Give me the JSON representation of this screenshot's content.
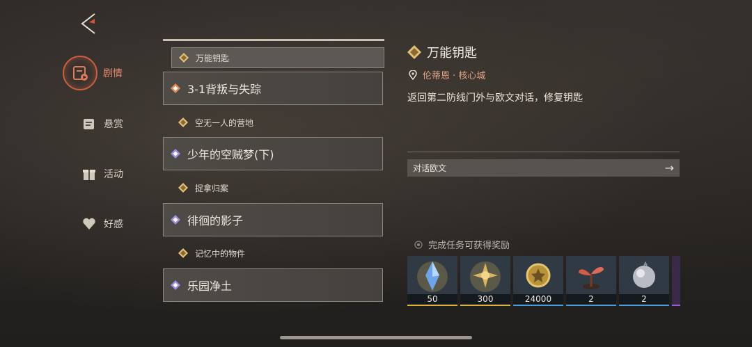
{
  "nav": {
    "items": [
      {
        "label": "剧情",
        "active": true
      },
      {
        "label": "悬赏",
        "active": false
      },
      {
        "label": "活动",
        "active": false
      },
      {
        "label": "好感",
        "active": false
      }
    ]
  },
  "quest_list": [
    {
      "title": "万能钥匙",
      "type": "small",
      "selected": true,
      "icon": "gold-diamond-icon"
    },
    {
      "title": "3-1背叛与失踪",
      "type": "big",
      "icon": "orange-diamond-icon"
    },
    {
      "title": "空无一人的营地",
      "type": "small",
      "icon": "gold-diamond-icon"
    },
    {
      "title": "少年的空贼梦(下)",
      "type": "big",
      "icon": "purple-diamond-icon"
    },
    {
      "title": "捉拿归案",
      "type": "small",
      "icon": "gold-diamond-icon"
    },
    {
      "title": "徘徊的影子",
      "type": "big",
      "icon": "purple-diamond-icon"
    },
    {
      "title": "记忆中的物件",
      "type": "small",
      "icon": "gold-diamond-icon"
    },
    {
      "title": "乐园净土",
      "type": "big",
      "icon": "purple-diamond-icon"
    }
  ],
  "detail": {
    "title": "万能钥匙",
    "location": "伦蒂恩 · 核心城",
    "description": "返回第二防线门外与欧文对话，修复钥匙",
    "action_label": "对话欧文"
  },
  "rewards": {
    "title": "完成任务可获得奖励",
    "items": [
      {
        "name": "crystal",
        "amount": "50",
        "rarity_color": "#d8b43a"
      },
      {
        "name": "gold-star-orb",
        "amount": "300",
        "rarity_color": "#d8b43a"
      },
      {
        "name": "gold-coin",
        "amount": "24000",
        "rarity_color": "#4a9bd8"
      },
      {
        "name": "red-sprout",
        "amount": "2",
        "rarity_color": "#4a9bd8"
      },
      {
        "name": "silver-orb",
        "amount": "2",
        "rarity_color": "#4a9bd8"
      }
    ]
  }
}
